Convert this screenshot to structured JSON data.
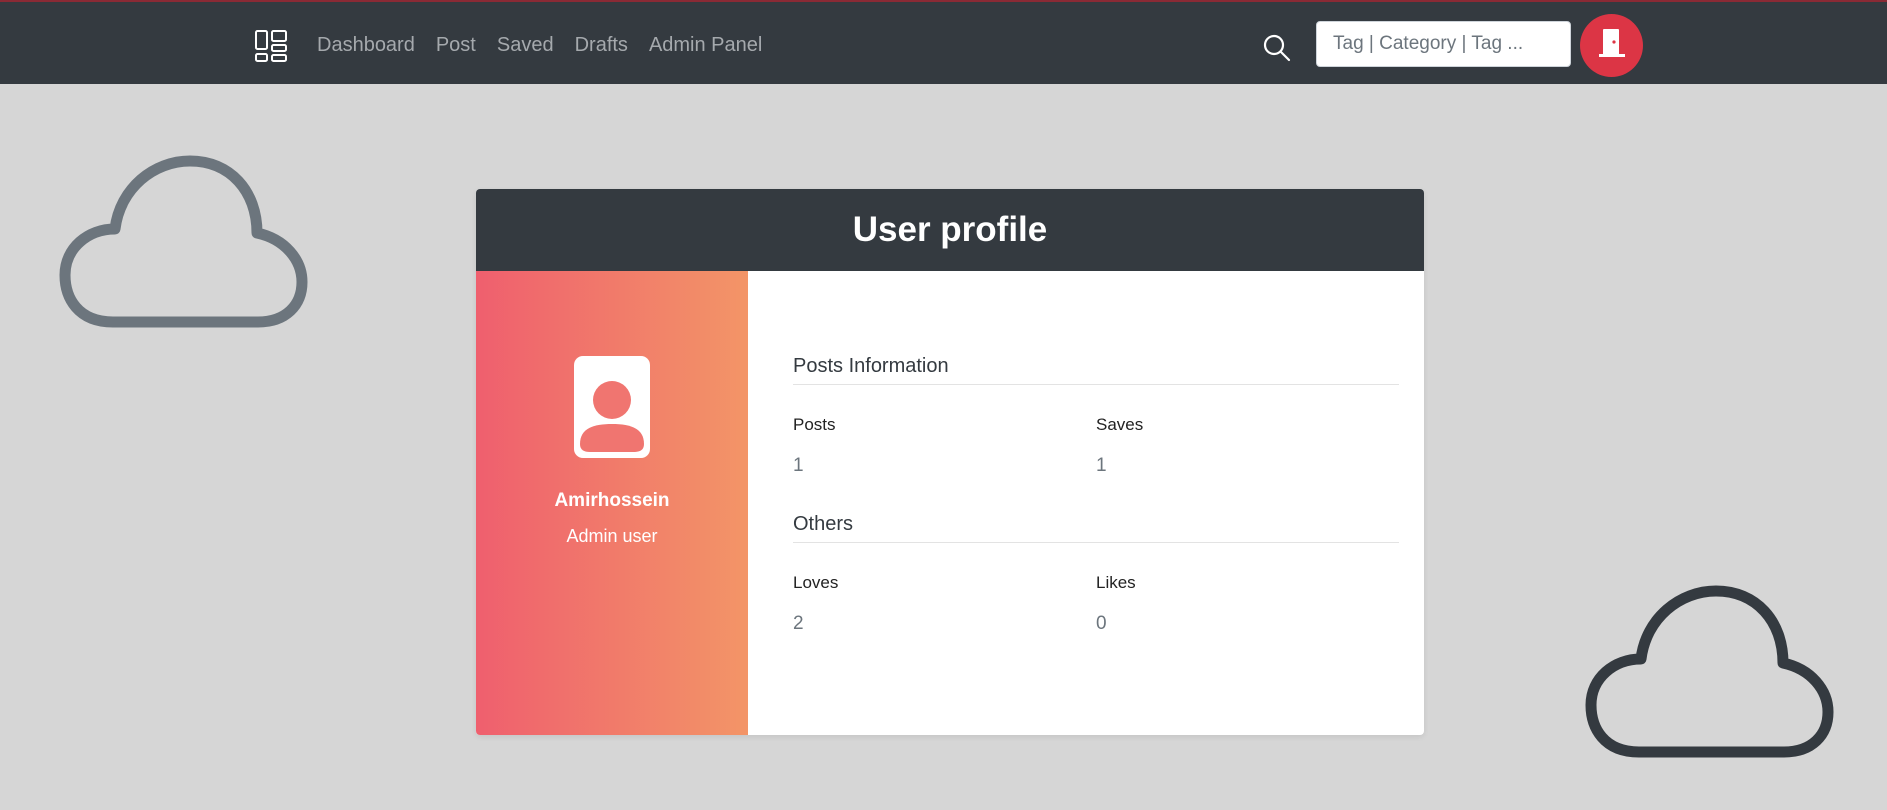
{
  "navbar": {
    "brand_icon": "dashboard-grid-icon",
    "links": [
      "Dashboard",
      "Post",
      "Saved",
      "Drafts",
      "Admin Panel"
    ],
    "search_icon": "search-icon",
    "search_placeholder": "Tag | Category | Tag ...",
    "search_value": "",
    "logout_icon": "door-icon"
  },
  "profile": {
    "title": "User profile",
    "avatar_icon": "person-badge-icon",
    "name": "Amirhossein",
    "role": "Admin user",
    "posts_section": {
      "title": "Posts Information",
      "stats": [
        {
          "label": "Posts",
          "value": "1"
        },
        {
          "label": "Saves",
          "value": "1"
        }
      ]
    },
    "others_section": {
      "title": "Others",
      "stats": [
        {
          "label": "Loves",
          "value": "2"
        },
        {
          "label": "Likes",
          "value": "0"
        }
      ]
    }
  },
  "decor": {
    "left_cloud_icon": "cloud-icon",
    "right_cloud_icon": "cloud-icon"
  },
  "colors": {
    "navbar": "#343a40",
    "background": "#d6d6d6",
    "logout": "#dc3545",
    "gradient_start": "#ef5f6e",
    "gradient_end": "#f39567",
    "cloud_left": "#6c757d",
    "cloud_right": "#343a40"
  }
}
